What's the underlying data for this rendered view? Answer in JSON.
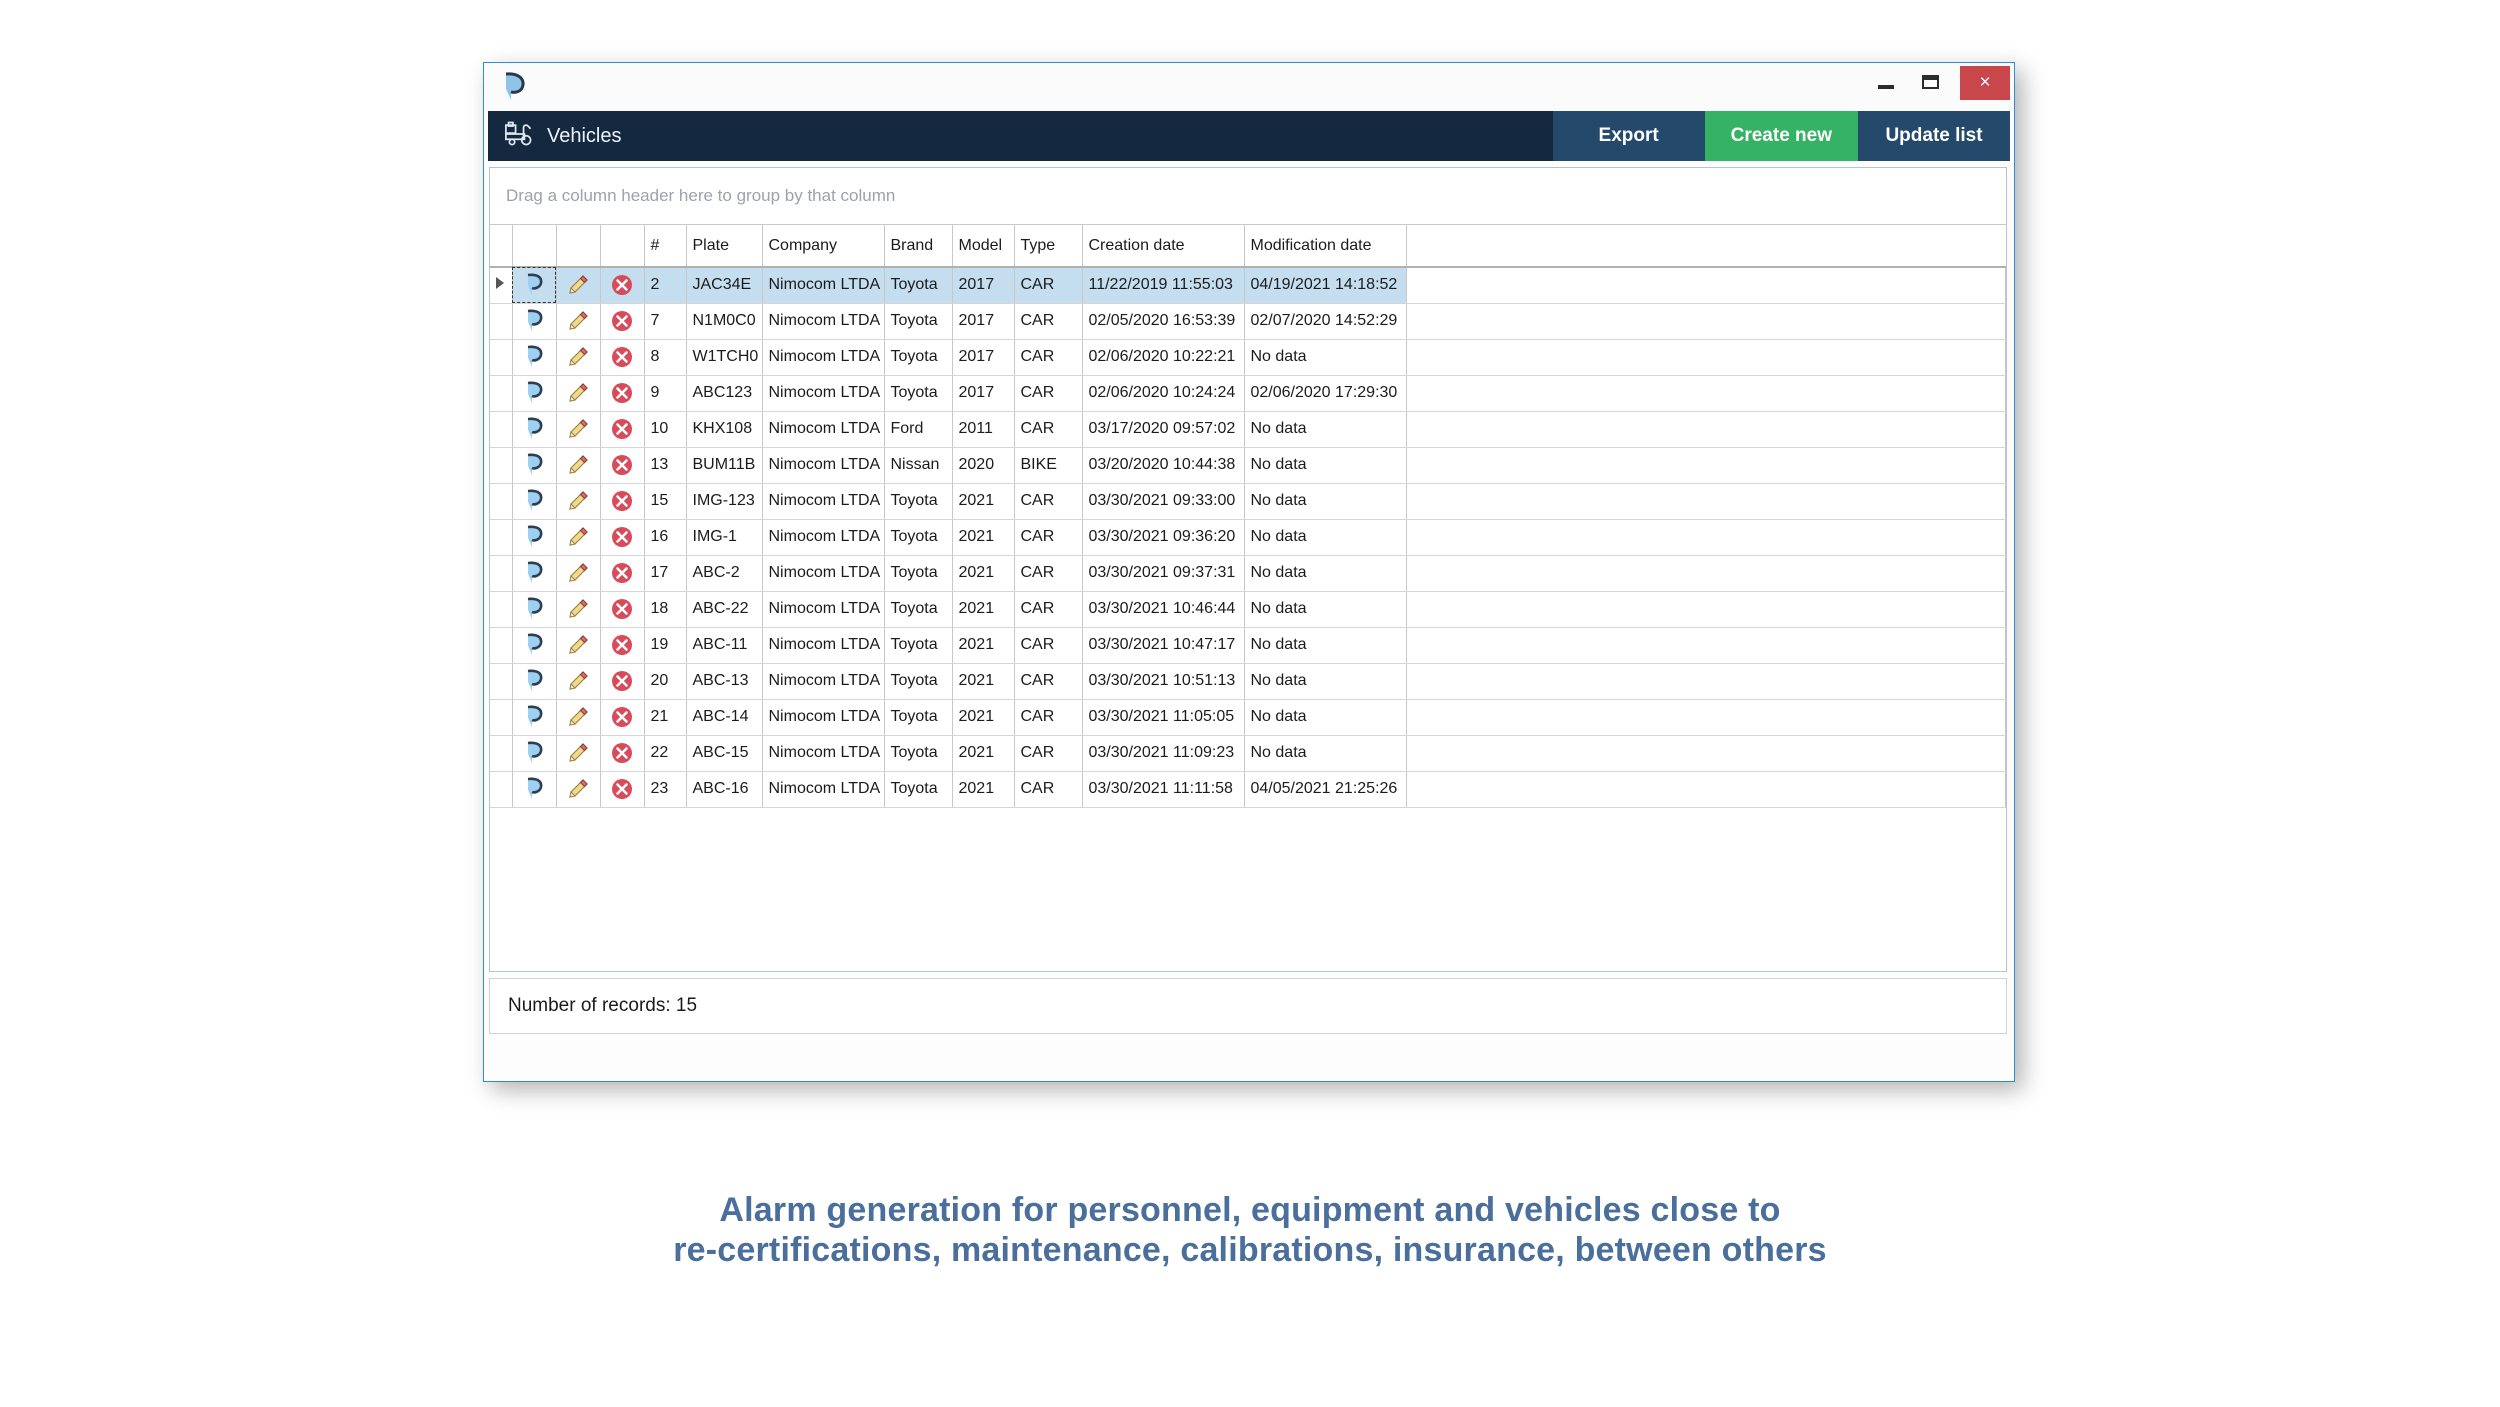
{
  "window": {
    "app_icon": "pin-icon",
    "controls": {
      "minimize": "minimize-icon",
      "maximize": "maximize-icon",
      "close": "×"
    }
  },
  "toolbar": {
    "icon": "truck-icon",
    "title": "Vehicles",
    "buttons": [
      {
        "label": "Export",
        "style": "dark"
      },
      {
        "label": "Create new",
        "style": "green"
      },
      {
        "label": "Update list",
        "style": "dark"
      }
    ]
  },
  "grid": {
    "group_panel_text": "Drag a column header here to group by that column",
    "action_icons": [
      "view-icon",
      "edit-icon",
      "delete-icon"
    ],
    "columns": [
      "#",
      "Plate",
      "Company",
      "Brand",
      "Model",
      "Type",
      "Creation date",
      "Modification date"
    ],
    "rows": [
      {
        "id": "2",
        "plate": "JAC34E",
        "company": "Nimocom LTDA",
        "brand": "Toyota",
        "model": "2017",
        "type": "CAR",
        "created": "11/22/2019 11:55:03",
        "modified": "04/19/2021 14:18:52",
        "selected": true
      },
      {
        "id": "7",
        "plate": "N1M0C0",
        "company": "Nimocom LTDA",
        "brand": "Toyota",
        "model": "2017",
        "type": "CAR",
        "created": "02/05/2020 16:53:39",
        "modified": "02/07/2020 14:52:29",
        "selected": false
      },
      {
        "id": "8",
        "plate": "W1TCH0",
        "company": "Nimocom LTDA",
        "brand": "Toyota",
        "model": "2017",
        "type": "CAR",
        "created": "02/06/2020 10:22:21",
        "modified": "No data",
        "selected": false
      },
      {
        "id": "9",
        "plate": "ABC123",
        "company": "Nimocom LTDA",
        "brand": "Toyota",
        "model": "2017",
        "type": "CAR",
        "created": "02/06/2020 10:24:24",
        "modified": "02/06/2020 17:29:30",
        "selected": false
      },
      {
        "id": "10",
        "plate": "KHX108",
        "company": "Nimocom LTDA",
        "brand": "Ford",
        "model": "2011",
        "type": "CAR",
        "created": "03/17/2020 09:57:02",
        "modified": "No data",
        "selected": false
      },
      {
        "id": "13",
        "plate": "BUM11B",
        "company": "Nimocom LTDA",
        "brand": "Nissan",
        "model": "2020",
        "type": "BIKE",
        "created": "03/20/2020 10:44:38",
        "modified": "No data",
        "selected": false
      },
      {
        "id": "15",
        "plate": "IMG-123",
        "company": "Nimocom LTDA",
        "brand": "Toyota",
        "model": "2021",
        "type": "CAR",
        "created": "03/30/2021 09:33:00",
        "modified": "No data",
        "selected": false
      },
      {
        "id": "16",
        "plate": "IMG-1",
        "company": "Nimocom LTDA",
        "brand": "Toyota",
        "model": "2021",
        "type": "CAR",
        "created": "03/30/2021 09:36:20",
        "modified": "No data",
        "selected": false
      },
      {
        "id": "17",
        "plate": "ABC-2",
        "company": "Nimocom LTDA",
        "brand": "Toyota",
        "model": "2021",
        "type": "CAR",
        "created": "03/30/2021 09:37:31",
        "modified": "No data",
        "selected": false
      },
      {
        "id": "18",
        "plate": "ABC-22",
        "company": "Nimocom LTDA",
        "brand": "Toyota",
        "model": "2021",
        "type": "CAR",
        "created": "03/30/2021 10:46:44",
        "modified": "No data",
        "selected": false
      },
      {
        "id": "19",
        "plate": "ABC-11",
        "company": "Nimocom LTDA",
        "brand": "Toyota",
        "model": "2021",
        "type": "CAR",
        "created": "03/30/2021 10:47:17",
        "modified": "No data",
        "selected": false
      },
      {
        "id": "20",
        "plate": "ABC-13",
        "company": "Nimocom LTDA",
        "brand": "Toyota",
        "model": "2021",
        "type": "CAR",
        "created": "03/30/2021 10:51:13",
        "modified": "No data",
        "selected": false
      },
      {
        "id": "21",
        "plate": "ABC-14",
        "company": "Nimocom LTDA",
        "brand": "Toyota",
        "model": "2021",
        "type": "CAR",
        "created": "03/30/2021 11:05:05",
        "modified": "No data",
        "selected": false
      },
      {
        "id": "22",
        "plate": "ABC-15",
        "company": "Nimocom LTDA",
        "brand": "Toyota",
        "model": "2021",
        "type": "CAR",
        "created": "03/30/2021 11:09:23",
        "modified": "No data",
        "selected": false
      },
      {
        "id": "23",
        "plate": "ABC-16",
        "company": "Nimocom LTDA",
        "brand": "Toyota",
        "model": "2021",
        "type": "CAR",
        "created": "03/30/2021 11:11:58",
        "modified": "04/05/2021 21:25:26",
        "selected": false
      }
    ]
  },
  "footer": {
    "records_text": "Number of records: 15"
  },
  "caption": {
    "line1": "Alarm generation for personnel, equipment and vehicles close to",
    "line2": "re-certifications, maintenance, calibrations, insurance, between others"
  },
  "colors": {
    "toolbar_bg": "#14283f",
    "button_bg": "#24496b",
    "button_green": "#35b264",
    "close_red": "#c9474a",
    "selection_blue": "#c4def0",
    "window_border": "#2e8bd4",
    "caption_text": "#4a6f9c",
    "delete_icon": "#d94a5a"
  }
}
